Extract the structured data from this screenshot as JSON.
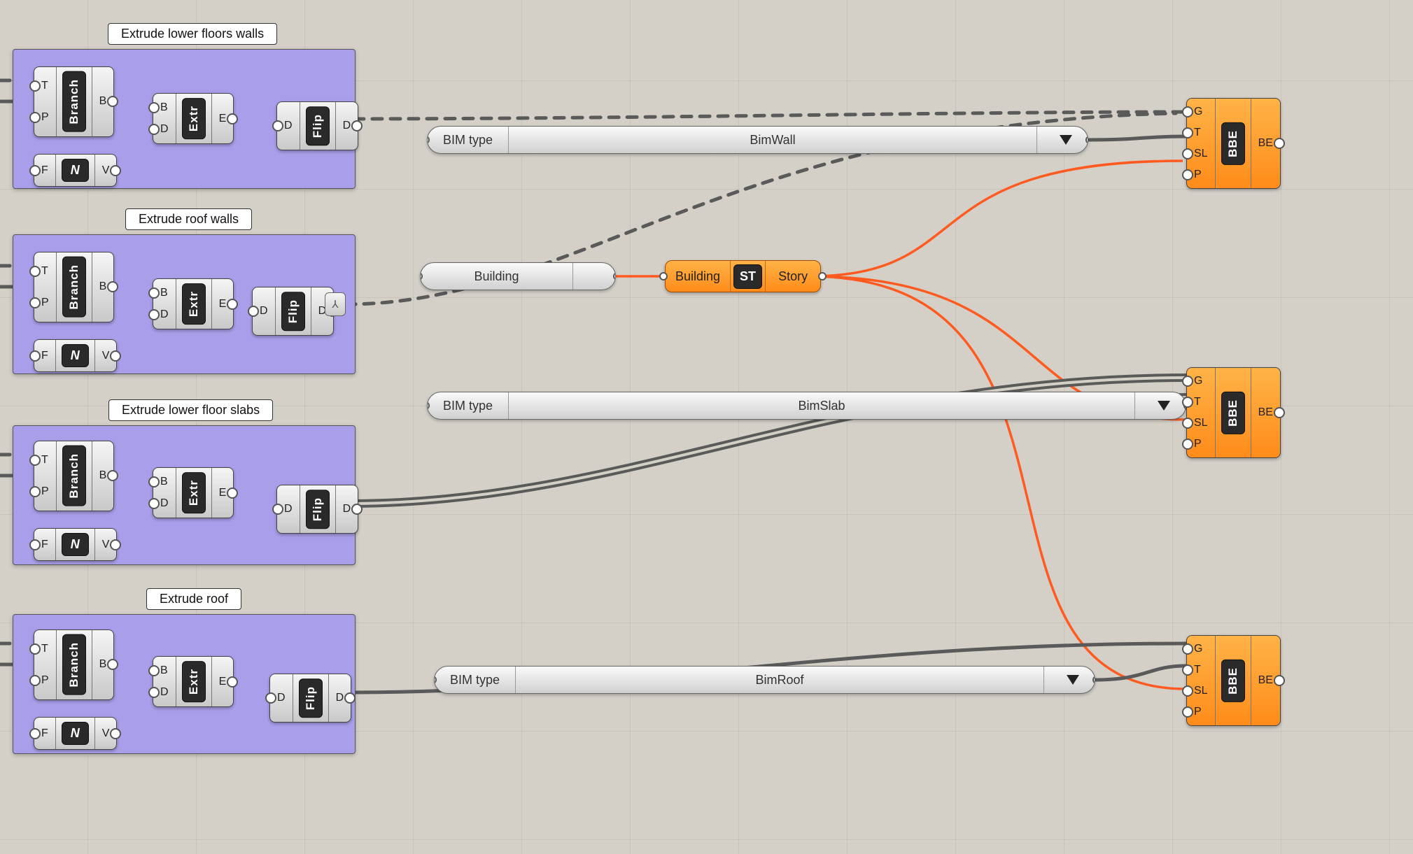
{
  "groups": [
    {
      "title": "Extrude lower floors walls"
    },
    {
      "title": "Extrude roof walls"
    },
    {
      "title": "Extrude lower floor slabs"
    },
    {
      "title": "Extrude roof"
    }
  ],
  "branch": {
    "label": "Branch",
    "in": [
      "T",
      "P"
    ],
    "out": [
      "B"
    ]
  },
  "negative": {
    "label": "N",
    "in": "F",
    "out": "V"
  },
  "extrude": {
    "label": "Extr",
    "in": [
      "B",
      "D"
    ],
    "out": [
      "E"
    ]
  },
  "flip": {
    "label": "Flip",
    "in": "D",
    "out": "D"
  },
  "relay": {
    "glyph": "⅄"
  },
  "panels": {
    "bim_type_label": "BIM type",
    "wall": "BimWall",
    "slab": "BimSlab",
    "roof": "BimRoof"
  },
  "building": {
    "label": "Building"
  },
  "story": {
    "in": "Building",
    "badge": "ST",
    "out": "Story"
  },
  "bbe": {
    "label": "BBE",
    "in": [
      "G",
      "T",
      "SL",
      "P"
    ],
    "out": [
      "BE"
    ]
  }
}
